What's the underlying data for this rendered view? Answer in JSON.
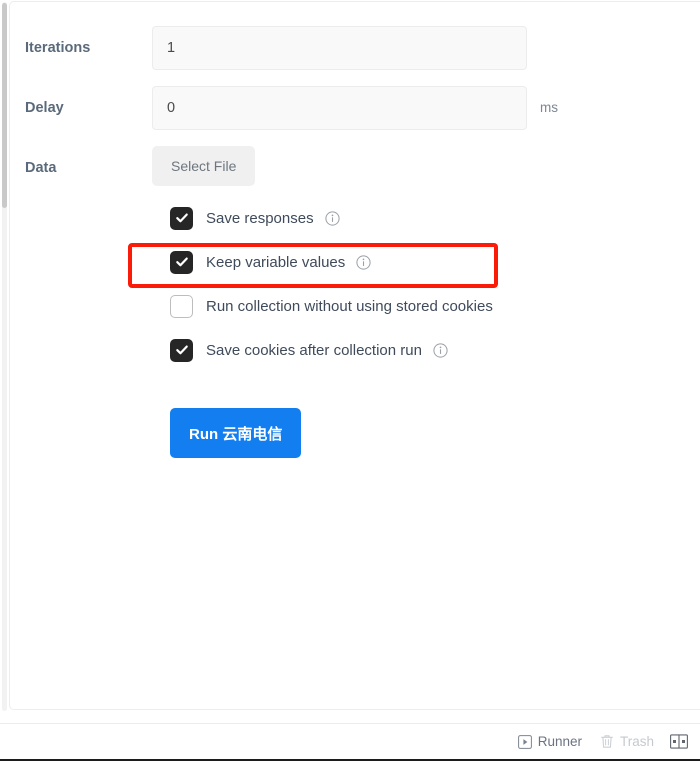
{
  "form": {
    "iterations": {
      "label": "Iterations",
      "value": "1",
      "placeholder": "1"
    },
    "delay": {
      "label": "Delay",
      "value": "0",
      "placeholder": "0",
      "unit": "ms"
    },
    "data": {
      "label": "Data",
      "select_file_label": "Select File"
    }
  },
  "options": [
    {
      "label": "Save responses",
      "checked": true,
      "has_info": true,
      "info_icon": "info-circle-icon",
      "highlighted": false
    },
    {
      "label": "Keep variable values",
      "checked": true,
      "has_info": true,
      "info_icon": "info-circle-icon",
      "highlighted": true
    },
    {
      "label": "Run collection without using stored cookies",
      "checked": false,
      "has_info": false,
      "info_icon": "",
      "highlighted": false
    },
    {
      "label": "Save cookies after collection run",
      "checked": true,
      "has_info": true,
      "info_icon": "info-circle-icon",
      "highlighted": false
    }
  ],
  "run_button": {
    "label": "Run 云南电信",
    "color": "#127ef0"
  },
  "highlight": {
    "color": "#fa1c09"
  },
  "status_bar": {
    "runner": {
      "label": "Runner",
      "icon": "play-square-icon",
      "enabled": true
    },
    "trash": {
      "label": "Trash",
      "icon": "trash-icon",
      "enabled": false
    },
    "layout_toggle": {
      "icon": "two-pane-layout-icon",
      "enabled": true
    }
  },
  "colors": {
    "checkbox_on": "#262626",
    "label_text": "#5a6a7a",
    "input_bg": "#f9f9f9"
  }
}
